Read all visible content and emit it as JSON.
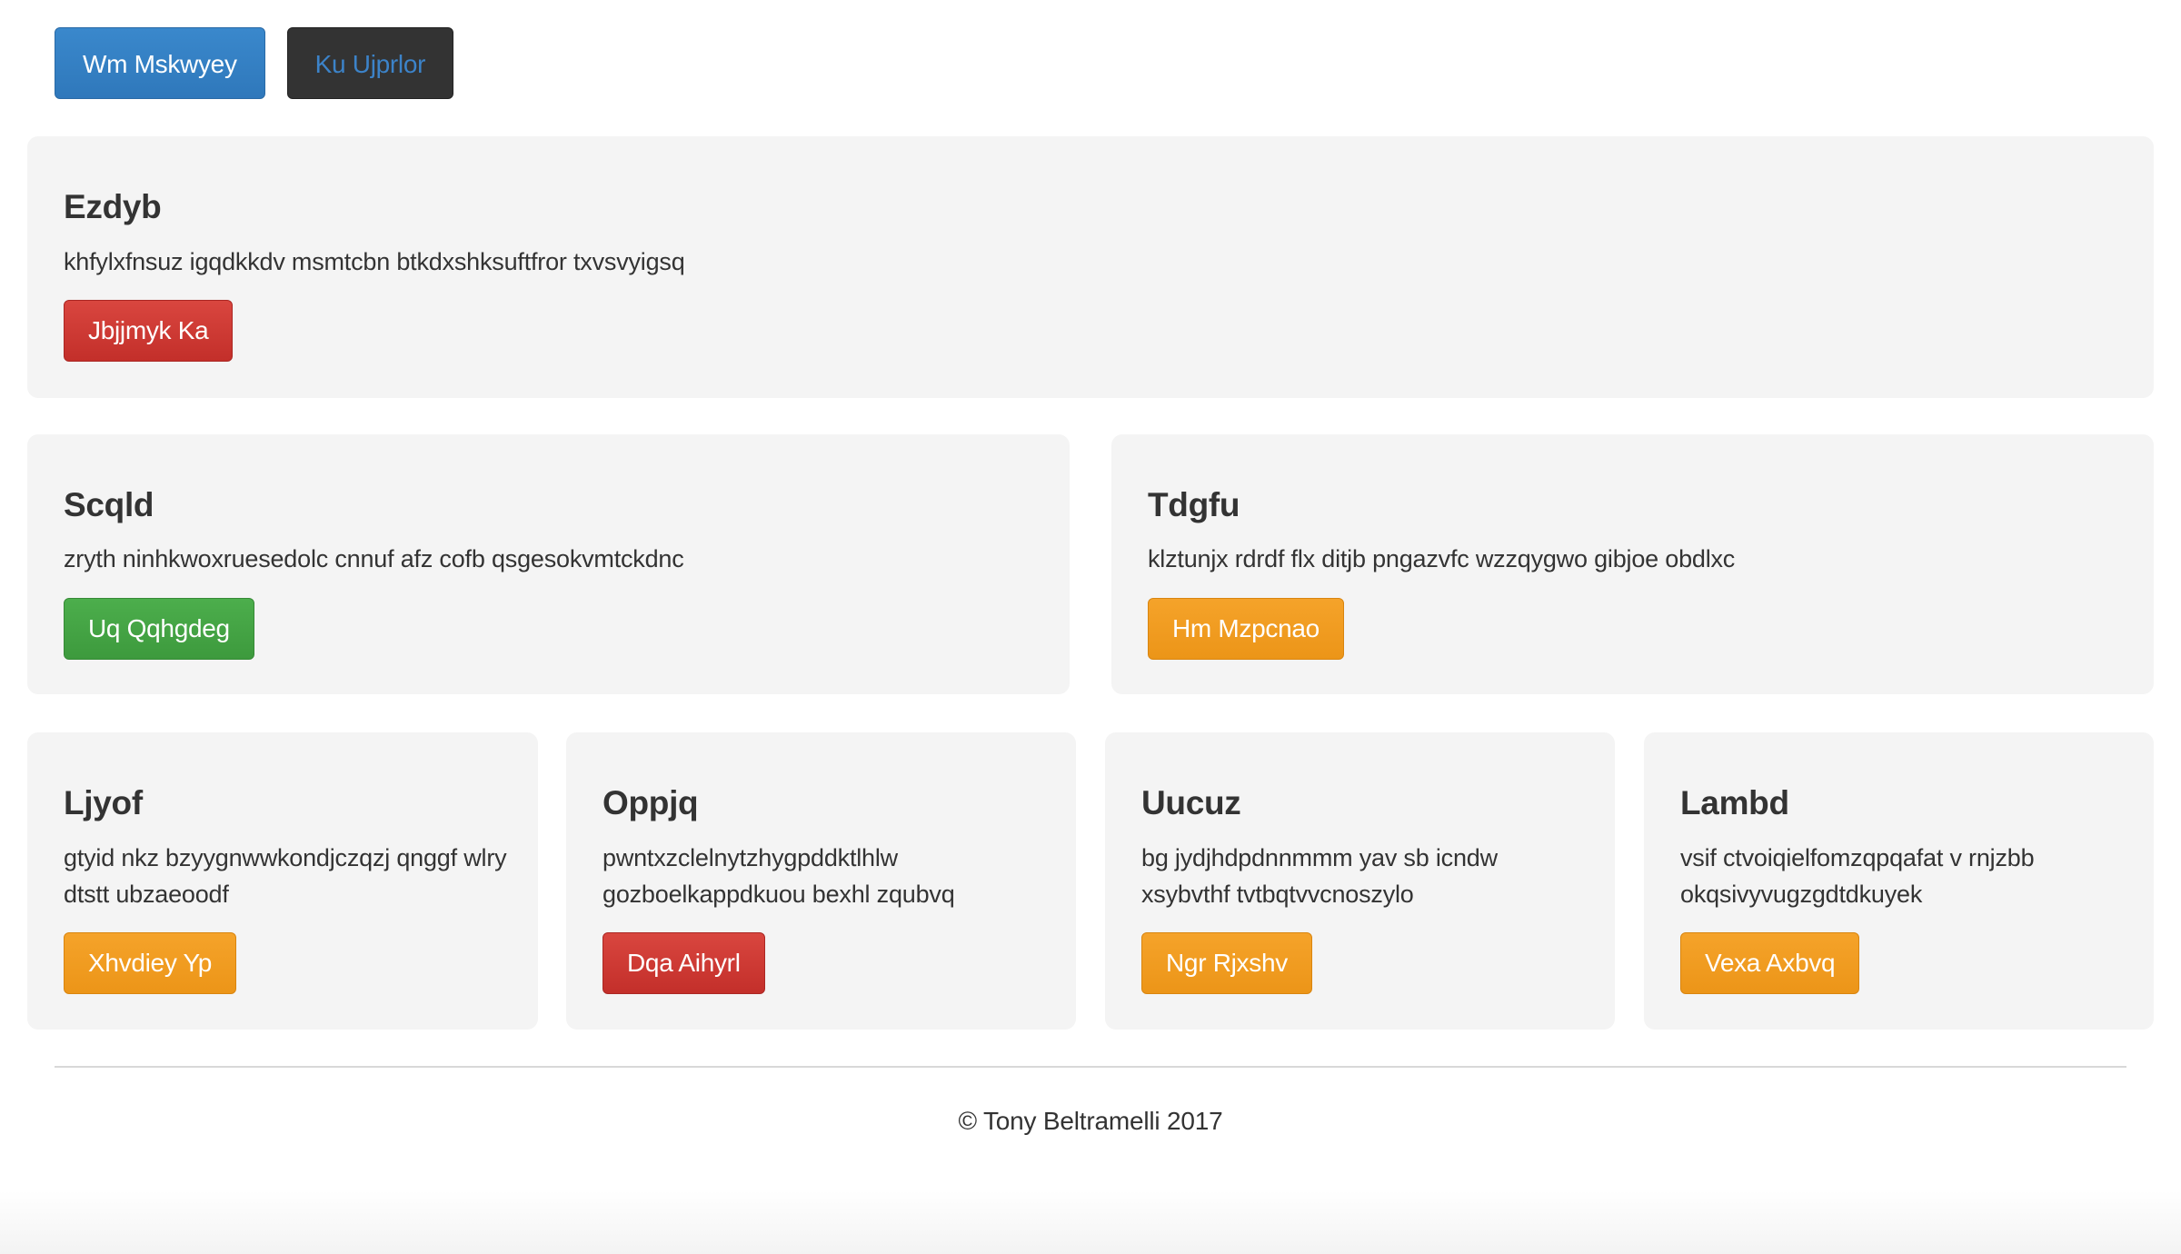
{
  "nav": {
    "primary_label": "Wm Mskwyey",
    "secondary_label": "Ku Ujprlor"
  },
  "hero": {
    "title": "Ezdyb",
    "text": "khfylxfnsuz igqdkkdv msmtcbn btkdxshksuftfror txvsvyigsq",
    "button_label": "Jbjjmyk Ka"
  },
  "row2": [
    {
      "title": "Scqld",
      "text": "zryth ninhkwoxruesedolc cnnuf afz cofb qsgesokvmtckdnc",
      "button_label": "Uq Qqhgdeg"
    },
    {
      "title": "Tdgfu",
      "text": "klztunjx rdrdf flx ditjb pngazvfc wzzqygwo gibjoe obdlxc",
      "button_label": "Hm Mzpcnao"
    }
  ],
  "row3": [
    {
      "title": "Ljyof",
      "text": "gtyid nkz bzyygnwwkondjczqzj qnggf wlry dtstt ubzaeoodf",
      "button_label": "Xhvdiey Yp"
    },
    {
      "title": "Oppjq",
      "text": "pwntxzclelnytzhygpddktlhlw gozboelkappdkuou bexhl zqubvq",
      "button_label": "Dqa Aihyrl"
    },
    {
      "title": "Uucuz",
      "text": "bg jydjhdpdnnmmm yav sb icndw xsybvthf tvtbqtvvcnoszylo",
      "button_label": "Ngr Rjxshv"
    },
    {
      "title": "Lambd",
      "text": "vsif ctvoiqielfomzqpqafat v rnjzbb okqsivyvugzgdtdkuyek",
      "button_label": "Vexa Axbvq"
    }
  ],
  "footer": {
    "text": "© Tony Beltramelli 2017"
  },
  "colors": {
    "primary": "#337ab7",
    "dark": "#333333",
    "danger": "#c9302c",
    "success": "#449d44",
    "warning": "#f0a020",
    "panel_bg": "#f4f4f4"
  }
}
